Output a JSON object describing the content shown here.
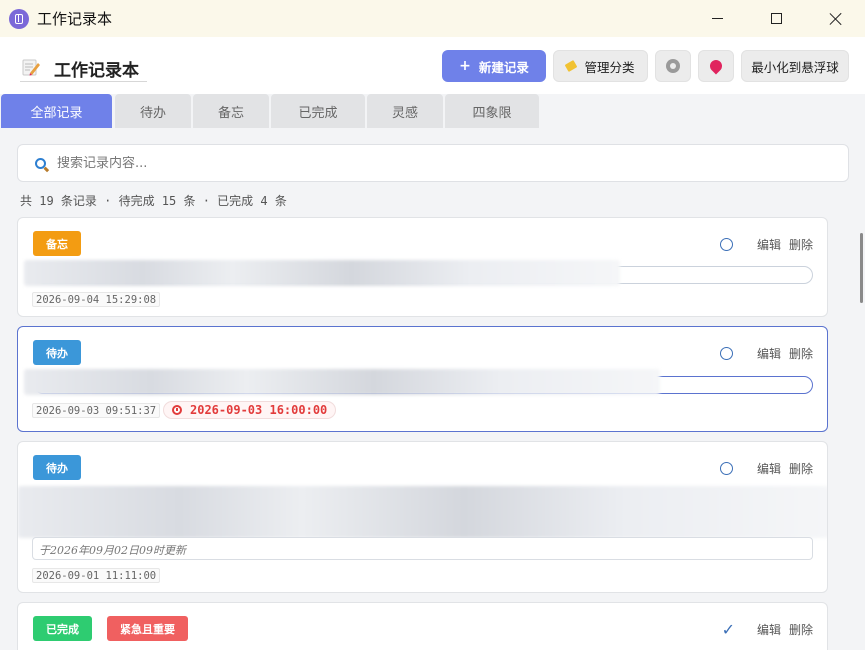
{
  "window": {
    "title": "工作记录本"
  },
  "header": {
    "title": "工作记录本",
    "new_button": "新建记录",
    "category_button": "管理分类",
    "float_button": "最小化到悬浮球"
  },
  "tabs": [
    {
      "label": "全部记录",
      "active": true
    },
    {
      "label": "待办",
      "active": false
    },
    {
      "label": "备忘",
      "active": false
    },
    {
      "label": "已完成",
      "active": false
    },
    {
      "label": "灵感",
      "active": false
    },
    {
      "label": "四象限",
      "active": false
    }
  ],
  "search": {
    "placeholder": "搜索记录内容..."
  },
  "stats": "共 19 条记录 · 待完成 15 条 · 已完成 4 条",
  "records": [
    {
      "category": "备忘",
      "timestamp": "2026-09-04 15:29:08",
      "actions": {
        "edit": "编辑",
        "delete": "删除"
      }
    },
    {
      "category": "待办",
      "timestamp": "2026-09-03 09:51:37",
      "reminder": "2026-09-03 16:00:00",
      "actions": {
        "edit": "编辑",
        "delete": "删除"
      }
    },
    {
      "category": "待办",
      "note": "于2026年09月02日09时更新",
      "timestamp": "2026-09-01 11:11:00",
      "actions": {
        "edit": "编辑",
        "delete": "删除"
      }
    },
    {
      "category": "已完成",
      "priority": "紧急且重要",
      "actions": {
        "edit": "编辑",
        "delete": "删除"
      }
    }
  ],
  "icons": {
    "app": "notebook-icon",
    "header": "memo-pencil-icon",
    "gear": "gear-icon",
    "pin": "pushpin-icon",
    "search": "magnifier-icon",
    "clock": "alarm-clock-icon"
  },
  "colors": {
    "accent": "#6f81e9",
    "memo": "#f39c12",
    "todo": "#3b97d9",
    "done": "#2ecc71",
    "urgent": "#f06060",
    "reminder": "#e23b3b"
  }
}
